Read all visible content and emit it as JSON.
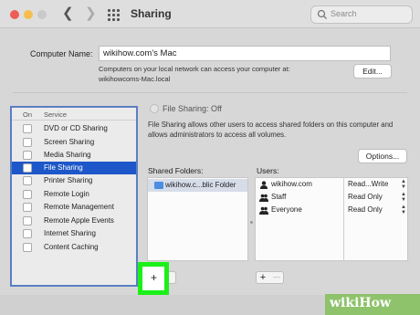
{
  "window": {
    "title": "Sharing",
    "back_icon": "chevron-left-icon",
    "forward_icon": "chevron-right-icon",
    "grid_icon": "grid-icon",
    "search_placeholder": "Search",
    "traffic_lights": {
      "close": "#ed5e57",
      "minimize": "#f5be4f",
      "zoom": "#c9c9c9"
    }
  },
  "computer_name": {
    "label": "Computer Name:",
    "value": "wikihow.com's Mac",
    "access_text": "Computers on your local network can access your computer at:",
    "local_address": "wikihowcoms-Mac.local",
    "edit_label": "Edit..."
  },
  "services": {
    "header_on": "On",
    "header_service": "Service",
    "items": [
      {
        "label": "DVD or CD Sharing",
        "selected": false
      },
      {
        "label": "Screen Sharing",
        "selected": false
      },
      {
        "label": "Media Sharing",
        "selected": false
      },
      {
        "label": "File Sharing",
        "selected": true
      },
      {
        "label": "Printer Sharing",
        "selected": false
      },
      {
        "label": "Remote Login",
        "selected": false
      },
      {
        "label": "Remote Management",
        "selected": false
      },
      {
        "label": "Remote Apple Events",
        "selected": false
      },
      {
        "label": "Internet Sharing",
        "selected": false
      },
      {
        "label": "Content Caching",
        "selected": false
      }
    ]
  },
  "file_sharing": {
    "status": "File Sharing: Off",
    "description": "File Sharing allows other users to access shared folders on this computer and allows administrators to access all volumes.",
    "options_label": "Options..."
  },
  "shared_folders": {
    "label": "Shared Folders:",
    "items": [
      {
        "label": "wikihow.c...blic Folder"
      }
    ],
    "add_label": "+",
    "remove_label": "—"
  },
  "users": {
    "label": "Users:",
    "items": [
      {
        "name": "wikihow.com",
        "permission": "Read...Write",
        "icon": "single-user-icon"
      },
      {
        "name": "Staff",
        "permission": "Read Only",
        "icon": "group-icon"
      },
      {
        "name": "Everyone",
        "permission": "Read Only",
        "icon": "group-icon"
      }
    ],
    "add_label": "+",
    "remove_label": "—"
  },
  "colors": {
    "selection": "#1d57c9",
    "highlight": "#1cf019",
    "watermark": "#8ec26b"
  },
  "watermark": {
    "prefix": "wiki",
    "suffix": "How"
  }
}
